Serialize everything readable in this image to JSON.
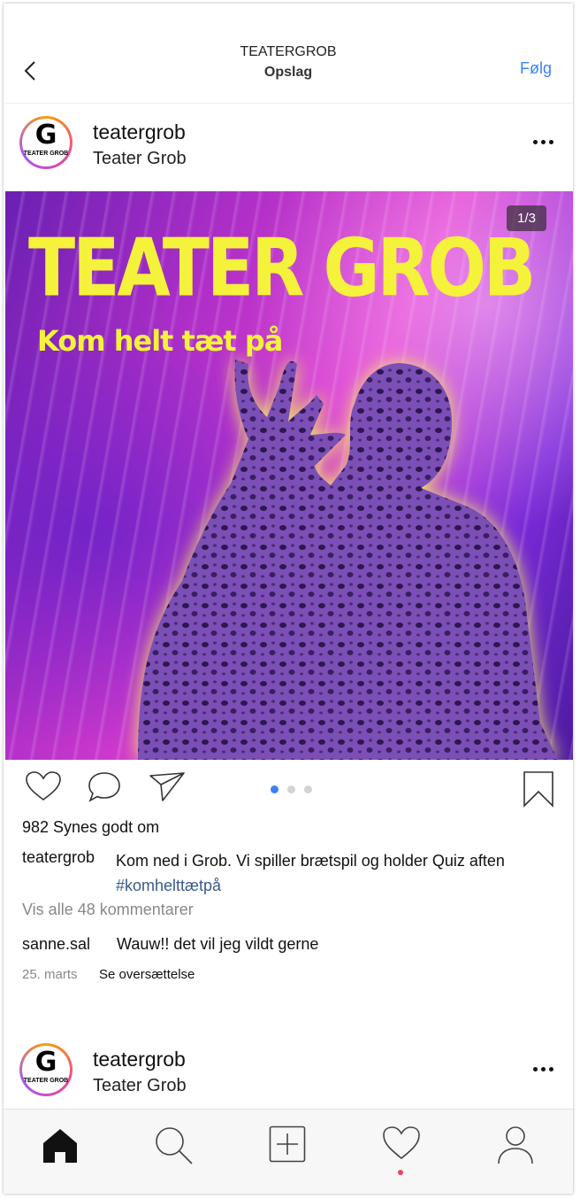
{
  "header": {
    "title": "TEATERGROB",
    "subtitle": "Opslag",
    "follow_label": "Følg"
  },
  "post": {
    "username": "teatergrob",
    "full_name": "Teater Grob",
    "avatar_text": "TEATER GROB",
    "image": {
      "counter": "1/3",
      "headline": "TEATER GROB",
      "tagline": "Kom helt tæt på",
      "page_count": 3,
      "current_page": 1
    },
    "likes": "982 Synes godt om",
    "caption": {
      "username": "teatergrob",
      "text": "Kom ned i Grob. Vi spiller brætspil og holder Quiz aften",
      "hashtag": "#komhelttætpå"
    },
    "view_all_comments": "Vis alle 48 kommentarer",
    "comment": {
      "username": "sanne.sal",
      "text": "Wauw!! det vil jeg vildt gerne",
      "date": "25. marts",
      "translate_label": "Se oversættelse"
    }
  },
  "next_post": {
    "username": "teatergrob",
    "full_name": "Teater Grob"
  },
  "tabbar": {
    "items": [
      "home-icon",
      "search-icon",
      "add-icon",
      "heart-icon",
      "profile-icon"
    ],
    "notification_color": "#e0485a"
  },
  "colors": {
    "accent": "#3b82f6",
    "headline": "#f4f23a",
    "hashtag": "#3a5a8a"
  }
}
